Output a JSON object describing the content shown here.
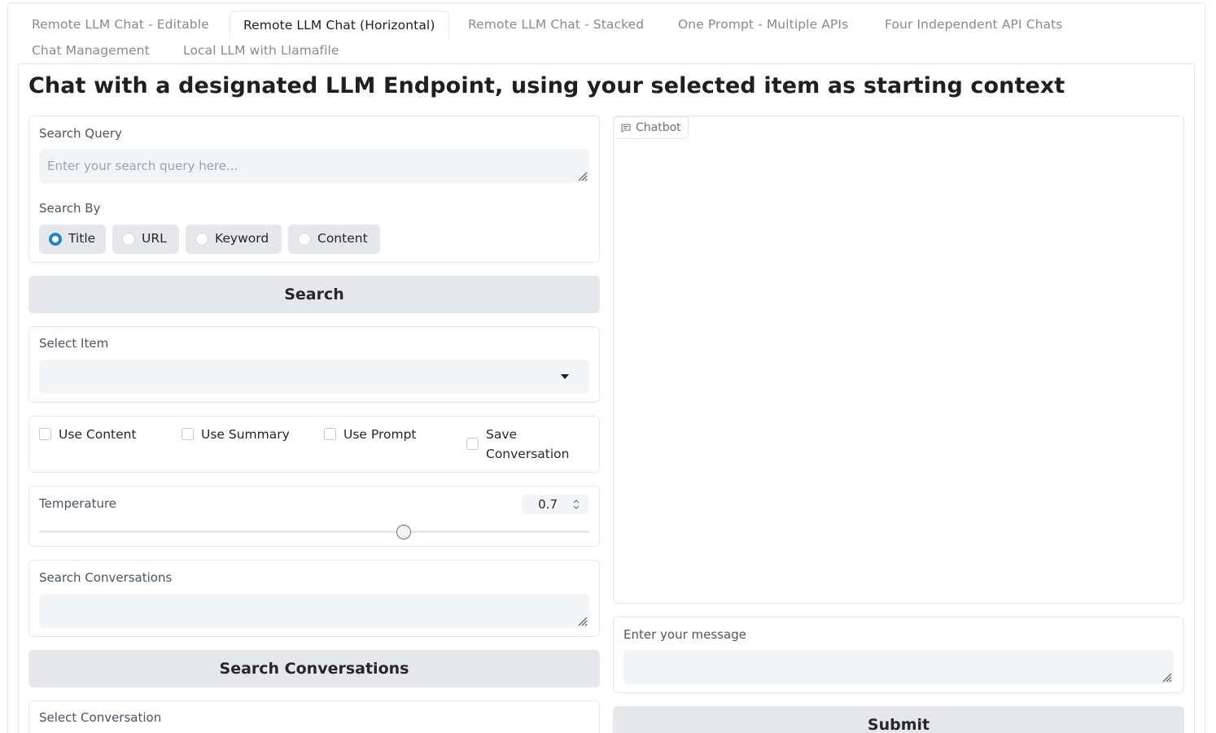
{
  "tabs": [
    {
      "label": "Remote LLM Chat - Editable",
      "active": false
    },
    {
      "label": "Remote LLM Chat (Horizontal)",
      "active": true
    },
    {
      "label": "Remote LLM Chat - Stacked",
      "active": false
    },
    {
      "label": "One Prompt - Multiple APIs",
      "active": false
    },
    {
      "label": "Four Independent API Chats",
      "active": false
    },
    {
      "label": "Chat Management",
      "active": false
    },
    {
      "label": "Local LLM with Llamafile",
      "active": false
    }
  ],
  "page_title": "Chat with a designated LLM Endpoint, using your selected item as starting context",
  "search_query": {
    "label": "Search Query",
    "value": "",
    "placeholder": "Enter your search query here..."
  },
  "search_by": {
    "label": "Search By",
    "options": [
      "Title",
      "URL",
      "Keyword",
      "Content"
    ],
    "selected": "Title"
  },
  "search_button": "Search",
  "select_item": {
    "label": "Select Item",
    "value": ""
  },
  "checkboxes": {
    "use_content": {
      "label": "Use Content",
      "checked": false
    },
    "use_summary": {
      "label": "Use Summary",
      "checked": false
    },
    "use_prompt": {
      "label": "Use Prompt",
      "checked": false
    },
    "save_conversation": {
      "label_line1": "Save",
      "label_line2": "Conversation",
      "checked": false
    }
  },
  "temperature": {
    "label": "Temperature",
    "value": "0.7",
    "min": 0,
    "max": 1
  },
  "search_conversations": {
    "label": "Search Conversations",
    "value": ""
  },
  "search_conversations_button": "Search Conversations",
  "select_conversation": {
    "label": "Select Conversation"
  },
  "chatbot": {
    "label": "Chatbot",
    "icon": "chat-icon"
  },
  "message": {
    "label": "Enter your message",
    "value": ""
  },
  "submit_button": "Submit",
  "colors": {
    "accent": "#2584c0",
    "button_bg": "#e5e7eb",
    "input_bg": "#f3f4f6",
    "border": "#e5e7eb"
  }
}
